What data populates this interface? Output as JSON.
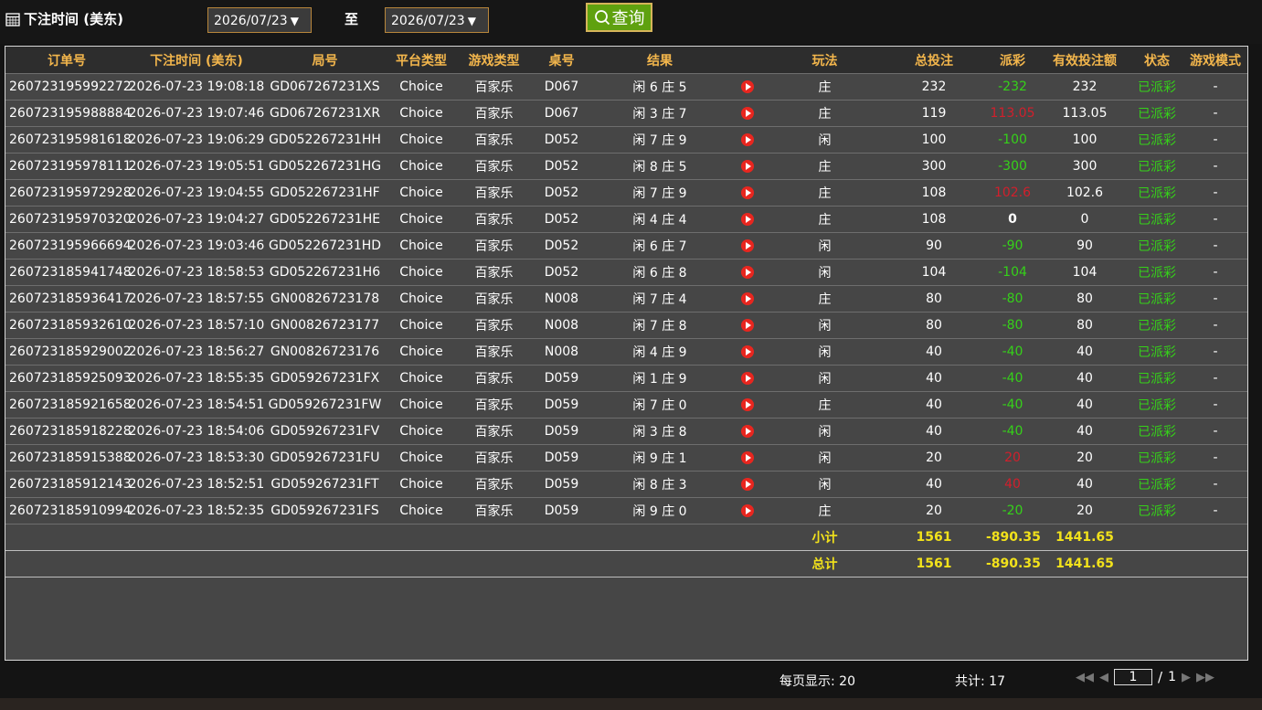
{
  "header": {
    "title": "下注时间 (美东)",
    "start_date": "2026/07/23",
    "to_label": "至",
    "end_date": "2026/07/23",
    "query_label": "查询"
  },
  "columns": [
    "订单号",
    "下注时间 (美东)",
    "局号",
    "平台类型",
    "游戏类型",
    "桌号",
    "结果",
    "",
    "玩法",
    "总投注",
    "派彩",
    "有效投注额",
    "状态",
    "游戏模式"
  ],
  "rows": [
    {
      "order": "260723195992272",
      "time": "2026-07-23 19:08:18",
      "round": "GD067267231XS",
      "platform": "Choice",
      "game": "百家乐",
      "table": "D067",
      "result": "闲 6 庄 5",
      "bet_type": "庄",
      "total_bet": "232",
      "payout": "-232",
      "payout_kind": "pos",
      "valid_bet": "232",
      "status": "已派彩",
      "mode": "-"
    },
    {
      "order": "260723195988884",
      "time": "2026-07-23 19:07:46",
      "round": "GD067267231XR",
      "platform": "Choice",
      "game": "百家乐",
      "table": "D067",
      "result": "闲 3 庄 7",
      "bet_type": "庄",
      "total_bet": "119",
      "payout": "113.05",
      "payout_kind": "neg",
      "valid_bet": "113.05",
      "status": "已派彩",
      "mode": "-"
    },
    {
      "order": "260723195981618",
      "time": "2026-07-23 19:06:29",
      "round": "GD052267231HH",
      "platform": "Choice",
      "game": "百家乐",
      "table": "D052",
      "result": "闲 7 庄 9",
      "bet_type": "闲",
      "total_bet": "100",
      "payout": "-100",
      "payout_kind": "pos",
      "valid_bet": "100",
      "status": "已派彩",
      "mode": "-"
    },
    {
      "order": "260723195978111",
      "time": "2026-07-23 19:05:51",
      "round": "GD052267231HG",
      "platform": "Choice",
      "game": "百家乐",
      "table": "D052",
      "result": "闲 8 庄 5",
      "bet_type": "庄",
      "total_bet": "300",
      "payout": "-300",
      "payout_kind": "pos",
      "valid_bet": "300",
      "status": "已派彩",
      "mode": "-"
    },
    {
      "order": "260723195972928",
      "time": "2026-07-23 19:04:55",
      "round": "GD052267231HF",
      "platform": "Choice",
      "game": "百家乐",
      "table": "D052",
      "result": "闲 7 庄 9",
      "bet_type": "庄",
      "total_bet": "108",
      "payout": "102.6",
      "payout_kind": "neg",
      "valid_bet": "102.6",
      "status": "已派彩",
      "mode": "-"
    },
    {
      "order": "260723195970320",
      "time": "2026-07-23 19:04:27",
      "round": "GD052267231HE",
      "platform": "Choice",
      "game": "百家乐",
      "table": "D052",
      "result": "闲 4 庄 4",
      "bet_type": "庄",
      "total_bet": "108",
      "payout": "0",
      "payout_kind": "zero",
      "valid_bet": "0",
      "status": "已派彩",
      "mode": "-"
    },
    {
      "order": "260723195966694",
      "time": "2026-07-23 19:03:46",
      "round": "GD052267231HD",
      "platform": "Choice",
      "game": "百家乐",
      "table": "D052",
      "result": "闲 6 庄 7",
      "bet_type": "闲",
      "total_bet": "90",
      "payout": "-90",
      "payout_kind": "pos",
      "valid_bet": "90",
      "status": "已派彩",
      "mode": "-"
    },
    {
      "order": "260723185941748",
      "time": "2026-07-23 18:58:53",
      "round": "GD052267231H6",
      "platform": "Choice",
      "game": "百家乐",
      "table": "D052",
      "result": "闲 6 庄 8",
      "bet_type": "闲",
      "total_bet": "104",
      "payout": "-104",
      "payout_kind": "pos",
      "valid_bet": "104",
      "status": "已派彩",
      "mode": "-"
    },
    {
      "order": "260723185936417",
      "time": "2026-07-23 18:57:55",
      "round": "GN00826723178",
      "platform": "Choice",
      "game": "百家乐",
      "table": "N008",
      "result": "闲 7 庄 4",
      "bet_type": "庄",
      "total_bet": "80",
      "payout": "-80",
      "payout_kind": "pos",
      "valid_bet": "80",
      "status": "已派彩",
      "mode": "-"
    },
    {
      "order": "260723185932610",
      "time": "2026-07-23 18:57:10",
      "round": "GN00826723177",
      "platform": "Choice",
      "game": "百家乐",
      "table": "N008",
      "result": "闲 7 庄 8",
      "bet_type": "闲",
      "total_bet": "80",
      "payout": "-80",
      "payout_kind": "pos",
      "valid_bet": "80",
      "status": "已派彩",
      "mode": "-"
    },
    {
      "order": "260723185929002",
      "time": "2026-07-23 18:56:27",
      "round": "GN00826723176",
      "platform": "Choice",
      "game": "百家乐",
      "table": "N008",
      "result": "闲 4 庄 9",
      "bet_type": "闲",
      "total_bet": "40",
      "payout": "-40",
      "payout_kind": "pos",
      "valid_bet": "40",
      "status": "已派彩",
      "mode": "-"
    },
    {
      "order": "260723185925093",
      "time": "2026-07-23 18:55:35",
      "round": "GD059267231FX",
      "platform": "Choice",
      "game": "百家乐",
      "table": "D059",
      "result": "闲 1 庄 9",
      "bet_type": "闲",
      "total_bet": "40",
      "payout": "-40",
      "payout_kind": "pos",
      "valid_bet": "40",
      "status": "已派彩",
      "mode": "-"
    },
    {
      "order": "260723185921658",
      "time": "2026-07-23 18:54:51",
      "round": "GD059267231FW",
      "platform": "Choice",
      "game": "百家乐",
      "table": "D059",
      "result": "闲 7 庄 0",
      "bet_type": "庄",
      "total_bet": "40",
      "payout": "-40",
      "payout_kind": "pos",
      "valid_bet": "40",
      "status": "已派彩",
      "mode": "-"
    },
    {
      "order": "260723185918228",
      "time": "2026-07-23 18:54:06",
      "round": "GD059267231FV",
      "platform": "Choice",
      "game": "百家乐",
      "table": "D059",
      "result": "闲 3 庄 8",
      "bet_type": "闲",
      "total_bet": "40",
      "payout": "-40",
      "payout_kind": "pos",
      "valid_bet": "40",
      "status": "已派彩",
      "mode": "-"
    },
    {
      "order": "260723185915388",
      "time": "2026-07-23 18:53:30",
      "round": "GD059267231FU",
      "platform": "Choice",
      "game": "百家乐",
      "table": "D059",
      "result": "闲 9 庄 1",
      "bet_type": "闲",
      "total_bet": "20",
      "payout": "20",
      "payout_kind": "neg",
      "valid_bet": "20",
      "status": "已派彩",
      "mode": "-"
    },
    {
      "order": "260723185912143",
      "time": "2026-07-23 18:52:51",
      "round": "GD059267231FT",
      "platform": "Choice",
      "game": "百家乐",
      "table": "D059",
      "result": "闲 8 庄 3",
      "bet_type": "闲",
      "total_bet": "40",
      "payout": "40",
      "payout_kind": "neg",
      "valid_bet": "40",
      "status": "已派彩",
      "mode": "-"
    },
    {
      "order": "260723185910994",
      "time": "2026-07-23 18:52:35",
      "round": "GD059267231FS",
      "platform": "Choice",
      "game": "百家乐",
      "table": "D059",
      "result": "闲 9 庄 0",
      "bet_type": "庄",
      "total_bet": "20",
      "payout": "-20",
      "payout_kind": "pos",
      "valid_bet": "20",
      "status": "已派彩",
      "mode": "-"
    }
  ],
  "subtotal": {
    "label": "小计",
    "total_bet": "1561",
    "payout": "-890.35",
    "valid_bet": "1441.65"
  },
  "grandtotal": {
    "label": "总计",
    "total_bet": "1561",
    "payout": "-890.35",
    "valid_bet": "1441.65"
  },
  "footer": {
    "per_page": "每页显示: 20",
    "total": "共计: 17",
    "current_page": "1",
    "page_sep": "/",
    "total_pages": "1"
  },
  "colors": {
    "header_text": "#f3b64c",
    "positive": "#35d119",
    "negative": "#d21f2c",
    "totals": "#f2e21b",
    "query_button": "#5fa10f"
  }
}
